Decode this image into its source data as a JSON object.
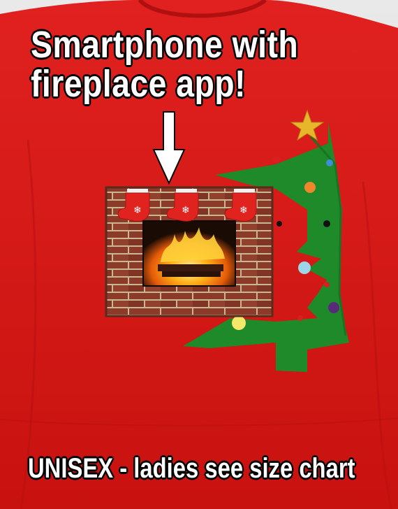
{
  "headline": {
    "line1": "Smartphone with",
    "line2": "fireplace app!"
  },
  "footer_text": "UNISEX - ladies see size chart",
  "colors": {
    "sweater": "#d71a1a",
    "tree": "#1f8a2a",
    "brick": "#8a3a2a",
    "text": "#ffffff",
    "text_outline": "#000000"
  },
  "icons": [
    "down-arrow-icon",
    "star-icon",
    "snowflake-icon",
    "stocking-icon"
  ]
}
